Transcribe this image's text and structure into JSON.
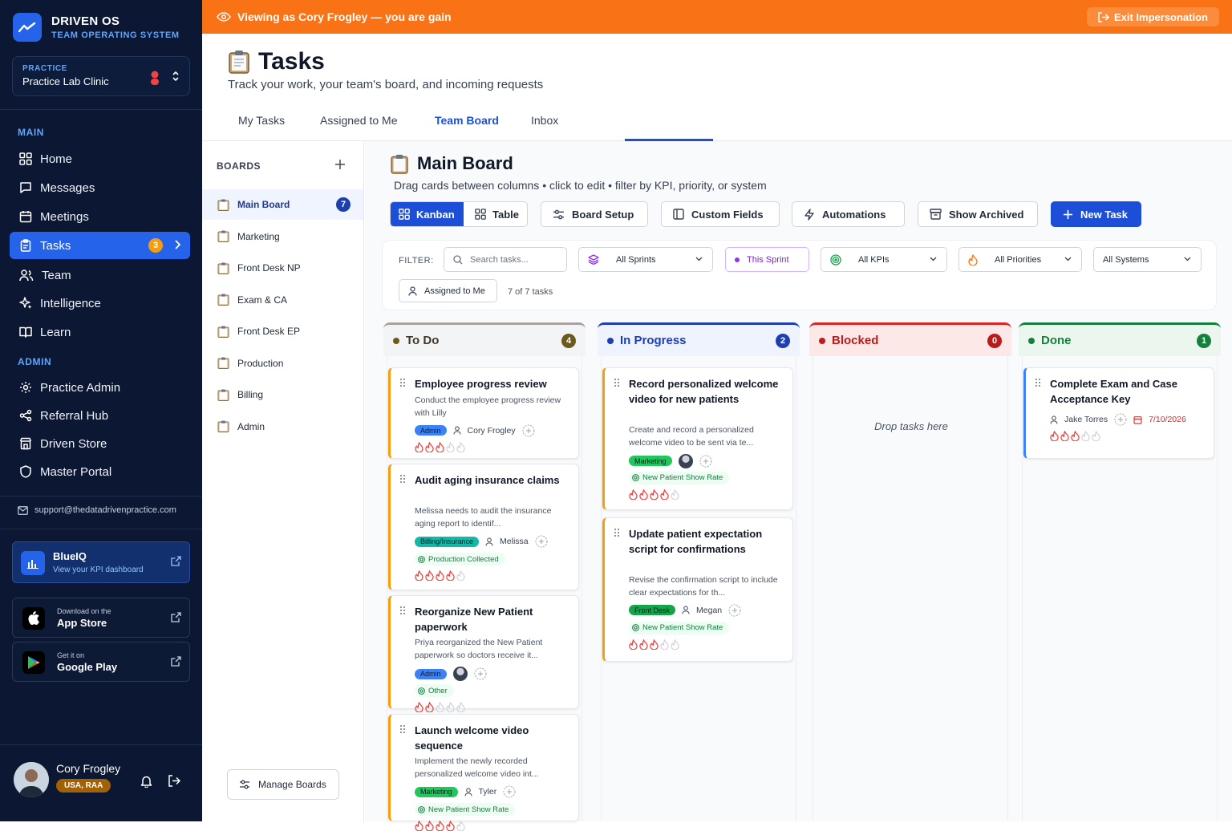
{
  "brand": {
    "name": "DRIVEN OS",
    "sub": "TEAM OPERATING SYSTEM"
  },
  "practice": {
    "label": "PRACTICE",
    "name": "Practice Lab Clinic"
  },
  "sidebar": {
    "main_label": "MAIN",
    "main_items": [
      {
        "label": "Home",
        "icon": "grid-icon"
      },
      {
        "label": "Messages",
        "icon": "chat-icon"
      },
      {
        "label": "Meetings",
        "icon": "calendar-icon"
      },
      {
        "label": "Tasks",
        "icon": "clipboard-icon",
        "badge": "3",
        "active": true
      },
      {
        "label": "Team",
        "icon": "users-icon"
      },
      {
        "label": "Intelligence",
        "icon": "sparkle-icon"
      },
      {
        "label": "Learn",
        "icon": "book-icon"
      }
    ],
    "admin_label": "ADMIN",
    "admin_items": [
      {
        "label": "Practice Admin",
        "icon": "gear-icon"
      },
      {
        "label": "Referral Hub",
        "icon": "share-icon"
      },
      {
        "label": "Driven Store",
        "icon": "store-icon"
      },
      {
        "label": "Master Portal",
        "icon": "shield-icon"
      }
    ],
    "support_email": "support@thedatadrivenpractice.com",
    "blueiq": {
      "title": "BlueIQ",
      "sub": "View your KPI dashboard"
    },
    "app_store": {
      "small": "Download on the",
      "big": "App Store"
    },
    "google_play": {
      "small": "Get it on",
      "big": "Google Play"
    },
    "user": {
      "name": "Cory Frogley",
      "tag": "USA, RAA"
    }
  },
  "banner": {
    "text": "Viewing as Cory Frogley — you are gain",
    "exit_label": "Exit Impersonation",
    "color": "#f97316"
  },
  "page": {
    "title": "Tasks",
    "subtitle": "Track your work, your team's board, and incoming requests"
  },
  "tabs": [
    "My Tasks",
    "Assigned to Me",
    "Team Board",
    "Inbox"
  ],
  "active_tab": "Team Board",
  "boards": {
    "header": "BOARDS",
    "items": [
      {
        "label": "Main Board",
        "count": "7",
        "active": true
      },
      {
        "label": "Marketing"
      },
      {
        "label": "Front Desk NP"
      },
      {
        "label": "Exam & CA"
      },
      {
        "label": "Front Desk EP"
      },
      {
        "label": "Production"
      },
      {
        "label": "Billing"
      },
      {
        "label": "Admin"
      }
    ],
    "manage_label": "Manage Boards"
  },
  "board": {
    "title": "Main Board",
    "subtitle": "Drag cards between columns • click to edit • filter by KPI, priority, or system",
    "view_kanban": "Kanban",
    "view_table": "Table",
    "buttons": {
      "setup": "Board Setup",
      "fields": "Custom Fields",
      "automations": "Automations",
      "archived": "Show Archived",
      "new_task": "New Task"
    }
  },
  "filters": {
    "label": "FILTER:",
    "search_placeholder": "Search tasks...",
    "sprints": "All Sprints",
    "this_sprint": "This Sprint",
    "kpis": "All KPIs",
    "priorities": "All Priorities",
    "systems": "All Systems",
    "assigned": "Assigned to Me",
    "count": "7 of 7 tasks"
  },
  "columns": [
    {
      "name": "To Do",
      "count": "4",
      "color": "#6b5a1e"
    },
    {
      "name": "In Progress",
      "count": "2",
      "color": "#1e40af"
    },
    {
      "name": "Blocked",
      "count": "0",
      "color": "#b91c1c",
      "empty": "Drop tasks here"
    },
    {
      "name": "Done",
      "count": "1",
      "color": "#15803d"
    }
  ],
  "cards": {
    "todo": [
      {
        "title": "Employee progress review",
        "desc": "Conduct the employee progress review with Lilly",
        "tag": "Admin",
        "assignee": "Cory Frogley",
        "priority": 3
      },
      {
        "title": "Audit aging insurance claims",
        "desc": "Melissa needs to audit the insurance aging report to identif...",
        "tag": "Billing/Insurance",
        "assignee": "Melissa",
        "kpi": "Production Collected",
        "priority": 4
      },
      {
        "title": "Reorganize New Patient paperwork",
        "desc": "Priya reorganized the New Patient paperwork so doctors receive it...",
        "tag": "Admin",
        "kpi": "Other",
        "priority": 2
      },
      {
        "title": "Launch welcome video sequence",
        "desc": "Implement the newly recorded personalized welcome video int...",
        "tag": "Marketing",
        "assignee": "Tyler",
        "kpi": "New Patient Show Rate",
        "priority": 4
      }
    ],
    "progress": [
      {
        "title": "Record personalized welcome video for new patients",
        "desc": "Create and record a personalized welcome video to be sent via te...",
        "tag": "Marketing",
        "kpi": "New Patient Show Rate",
        "priority": 4
      },
      {
        "title": "Update patient expectation script for confirmations",
        "desc": "Revise the confirmation script to include clear expectations for th...",
        "tag": "Front Desk",
        "assignee": "Megan",
        "kpi": "New Patient Show Rate",
        "priority": 3
      }
    ],
    "done": [
      {
        "title": "Complete Exam and Case Acceptance Key",
        "assignee": "Jake Torres",
        "due": "7/10/2026",
        "priority": 3
      }
    ]
  }
}
